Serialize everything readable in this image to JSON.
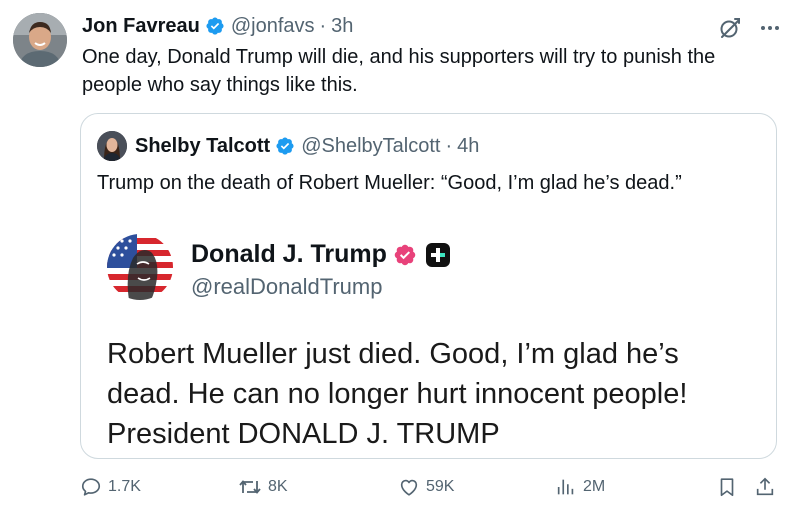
{
  "post": {
    "author_name": "Jon Favreau",
    "handle": "@jonfavs",
    "separator": "·",
    "time": "3h",
    "text": "One day, Donald Trump will die, and his supporters will try to punish the people who say things like this."
  },
  "quote": {
    "author_name": "Shelby Talcott",
    "handle": "@ShelbyTalcott",
    "separator": "·",
    "time": "4h",
    "text": "Trump on the death of Robert Mueller: “Good, I’m glad he’s dead.”"
  },
  "embedded": {
    "author_name": "Donald J. Trump",
    "handle": "@realDonaldTrump",
    "lines": [
      "Robert Mueller just died. Good, I’m glad he’s",
      "dead. He can no longer hurt innocent people!",
      "President DONALD J. TRUMP"
    ]
  },
  "actions": {
    "replies": "1.7K",
    "reposts": "8K",
    "likes": "59K",
    "views": "2M"
  },
  "colors": {
    "verified_blue": "#1d9bf0",
    "secondary_text": "#536471",
    "truth_badge_pink": "#e8427a"
  },
  "icons": [
    "verified-badge-icon",
    "grok-icon",
    "more-icon",
    "reply-icon",
    "repost-icon",
    "like-icon",
    "views-icon",
    "bookmark-icon",
    "share-icon",
    "truth-verified-icon",
    "truth-plus-icon"
  ]
}
